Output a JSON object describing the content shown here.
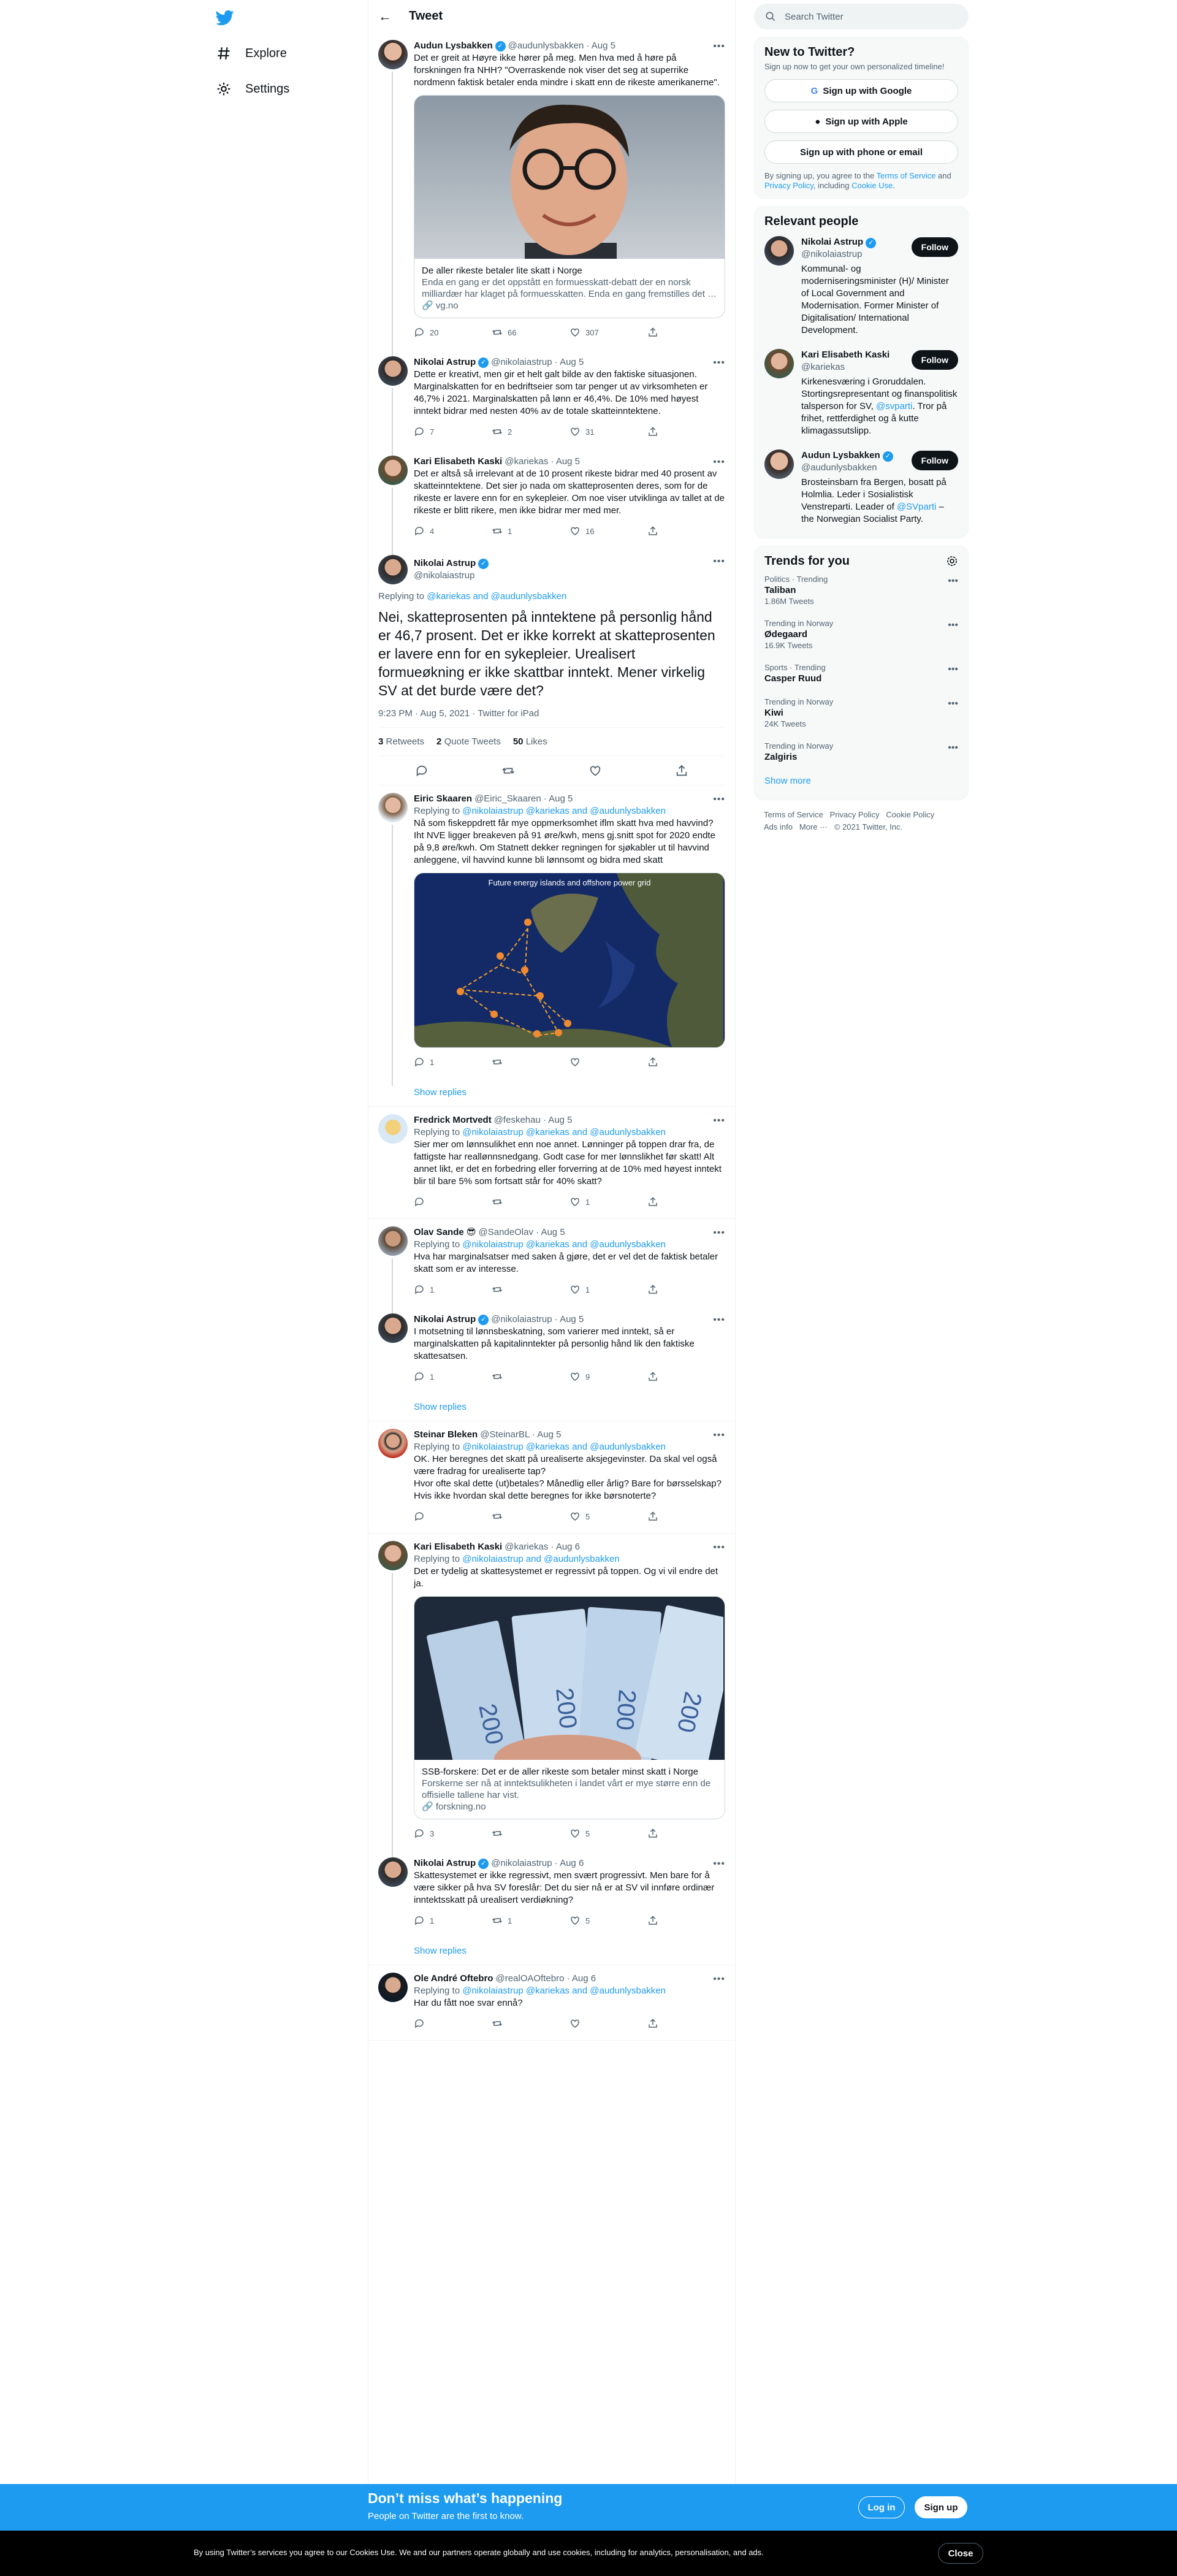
{
  "colors": {
    "accent": "#1d9bf0",
    "text": "#0f1419",
    "muted": "#536471"
  },
  "nav": {
    "explore": "Explore",
    "settings": "Settings"
  },
  "header": {
    "title": "Tweet"
  },
  "tweets": [
    {
      "name": "Audun Lysbakken",
      "meta": "@audunlysbakken · Aug 5",
      "replying": "",
      "text": "Det er greit at Høyre ikke hører på meg. Men hva med å høre på forskningen fra NHH? \"Overraskende nok viser det seg at superrike nordmenn faktisk betaler enda mindre i skatt enn de rikeste amerikanerne\".",
      "card_title": "De aller rikeste betaler lite skatt i Norge",
      "card_desc": "Enda en gang er det oppstått en formuesskatt-debatt der en norsk milliardær har klaget på formuesskatten. Enda en gang fremstilles det …",
      "card_domain": "vg.no",
      "reply": "20",
      "retweet": "66",
      "like": "307"
    },
    {
      "name": "Nikolai Astrup",
      "meta": "@nikolaiastrup · Aug 5",
      "replying": "",
      "text": "Dette er kreativt, men gir et helt galt bilde av den faktiske situasjonen. Marginalskatten for en bedriftseier som tar penger ut av virksomheten er 46,7% i 2021. Marginalskatten på lønn er 46,4%. De 10% med høyest inntekt bidrar med nesten 40% av de totale skatteinntektene.",
      "reply": "7",
      "retweet": "2",
      "like": "31"
    },
    {
      "name": "Kari Elisabeth Kaski",
      "meta": "@kariekas · Aug 5",
      "replying": "",
      "text": "Det er altså så irrelevant at de 10 prosent rikeste bidrar med 40 prosent av skatteinntektene. Det sier jo nada om skatteprosenten deres, som for de rikeste er lavere enn for en sykepleier. Om noe viser utviklinga av tallet at de rikeste er blitt rikere, men ikke bidrar mer med mer.",
      "reply": "4",
      "retweet": "1",
      "like": "16"
    }
  ],
  "focal": {
    "name": "Nikolai Astrup",
    "handle": "@nikolaiastrup",
    "replying_prefix": "Replying to ",
    "replying_users": "@kariekas and @audunlysbakken",
    "text": "Nei, skatteprosenten på inntektene på personlig hånd er 46,7 prosent. Det er ikke korrekt at skatteprosenten er lavere enn for en sykepleier. Urealisert formueøkning er ikke skattbar inntekt. Mener virkelig SV at det burde være det?",
    "timestamp": "9:23 PM · Aug 5, 2021 · Twitter for iPad",
    "retweets_num": "3",
    "retweets_label": "Retweets",
    "quotes_num": "2",
    "quotes_label": "Quote Tweets",
    "likes_num": "50",
    "likes_label": "Likes"
  },
  "replies": [
    {
      "name": "Eiric Skaaren",
      "meta": "@Eiric_Skaaren · Aug 5",
      "replying_prefix": "Replying to ",
      "replying_users": "@nikolaiastrup @kariekas and @audunlysbakken",
      "text": "Nå som fiskeppdrett får mye oppmerksomhet iflm skatt hva med havvind? Iht NVE ligger breakeven på 91 øre/kwh, mens gj.snitt spot for 2020 endte på 9,8 øre/kwh. Om Statnett dekker regningen for sjøkabler ut til havvind anleggene, vil havvind kunne bli lønnsomt og bidra med skatt",
      "media_title": "Future energy islands and offshore power grid",
      "reply": "1",
      "retweet": "",
      "like": ""
    },
    {
      "name": "Fredrick Mortvedt",
      "meta": "@feskehau · Aug 5",
      "replying_prefix": "Replying to ",
      "replying_users": "@nikolaiastrup @kariekas and @audunlysbakken",
      "text": "Sier mer om lønnsulikhet enn noe annet. Lønninger på toppen drar fra, de fattigste har reallønnsnedgang. Godt case for mer lønnslikhet før skatt! Alt annet likt, er det en forbedring eller forverring at de 10% med høyest inntekt blir til bare 5% som fortsatt står for 40% skatt?",
      "reply": "",
      "retweet": "",
      "like": "1"
    },
    {
      "name": "Olav Sande 😎",
      "meta": "@SandeOlav · Aug 5",
      "replying_prefix": "Replying to ",
      "replying_users": "@nikolaiastrup @kariekas and @audunlysbakken",
      "text": "Hva har marginalsatser med saken å gjøre, det er vel det de faktisk betaler skatt som er av interesse.",
      "reply": "1",
      "retweet": "",
      "like": "1"
    },
    {
      "name": "Nikolai Astrup",
      "meta": "@nikolaiastrup · Aug 5",
      "replying_prefix": "",
      "replying_users": "",
      "text": "I motsetning til lønnsbeskatning, som varierer med inntekt, så er marginalskatten på kapitalinntekter på personlig hånd lik den faktiske skattesatsen.",
      "reply": "1",
      "retweet": "",
      "like": "9"
    },
    {
      "name": "Steinar Bleken",
      "meta": "@SteinarBL · Aug 5",
      "replying_prefix": "Replying to ",
      "replying_users": "@nikolaiastrup @kariekas and @audunlysbakken",
      "text": "OK. Her beregnes det skatt på urealiserte aksjegevinster. Da skal vel også være fradrag for urealiserte tap?\nHvor ofte skal dette (ut)betales? Månedlig eller årlig? Bare for børsselskap?\nHvis ikke hvordan skal dette beregnes for ikke børsnoterte?",
      "reply": "",
      "retweet": "",
      "like": "5"
    },
    {
      "name": "Kari Elisabeth Kaski",
      "meta": "@kariekas · Aug 6",
      "replying_prefix": "Replying to ",
      "replying_users": "@nikolaiastrup and @audunlysbakken",
      "text": "Det er tydelig at skattesystemet er regressivt på toppen. Og vi vil endre det ja.",
      "card_title": "SSB-forskere: Det er de aller rikeste som betaler minst skatt i Norge",
      "card_desc": "Forskerne ser nå at inntektsulikheten i landet vårt er mye større enn de offisielle tallene har vist.",
      "card_domain": "forskning.no",
      "reply": "3",
      "retweet": "",
      "like": "5"
    },
    {
      "name": "Nikolai Astrup",
      "meta": "@nikolaiastrup · Aug 6",
      "replying_prefix": "",
      "replying_users": "",
      "text": "Skattesystemet er ikke regressivt, men svært progressivt. Men bare for å være sikker på hva SV foreslår: Det du sier nå er at SV vil innføre ordinær inntektsskatt på urealisert verdiøkning?",
      "reply": "1",
      "retweet": "1",
      "like": "5"
    },
    {
      "name": "Ole André Oftebro",
      "meta": "@realOAOftebro · Aug 6",
      "replying_prefix": "Replying to ",
      "replying_users": "@nikolaiastrup @kariekas and @audunlysbakken",
      "text": "Har du fått noe svar ennå?",
      "reply": "",
      "retweet": "",
      "like": ""
    }
  ],
  "show_replies": "Show replies",
  "search": {
    "placeholder": "Search Twitter"
  },
  "signup": {
    "title": "New to Twitter?",
    "subtitle": "Sign up now to get your own personalized timeline!",
    "google": "Sign up with Google",
    "apple": "Sign up with Apple",
    "phone": "Sign up with phone or email",
    "terms_a": "By signing up, you agree to the ",
    "terms_link1": "Terms of Service",
    "terms_b": " and ",
    "terms_link2": "Privacy Policy",
    "terms_c": ", including ",
    "terms_link3": "Cookie Use",
    "terms_d": "."
  },
  "relevant": {
    "title": "Relevant people",
    "follow": "Follow",
    "people": [
      {
        "name": "Nikolai Astrup",
        "handle": "@nikolaiastrup",
        "bio": "Kommunal- og moderniseringsminister (H)/ Minister of Local Government and Modernisation. Former Minister of Digitalisation/ International Development."
      },
      {
        "name": "Kari Elisabeth Kaski",
        "handle": "@kariekas",
        "bio_a": "Kirkenesværing i Grorud​dalen. Stortingsrepresentant og finanspolitisk talsperson for SV, ",
        "bio_link": "@svparti",
        "bio_b": ". Tror på frihet, rettferdighet og å kutte klimagassutslipp."
      },
      {
        "name": "Audun Lysbakken",
        "handle": "@audunlysbakken",
        "bio_a": "Brosteinsbarn fra Bergen, bosatt på Holmlia. Leder i Sosialistisk Venstreparti. Leader of ",
        "bio_link": "@SVparti",
        "bio_b": " – the Norwegian Socialist Party."
      }
    ]
  },
  "trends": {
    "title": "Trends for you",
    "items": [
      {
        "cat": "Politics · Trending",
        "name": "Taliban",
        "count": "1.86M Tweets"
      },
      {
        "cat": "Trending in Norway",
        "name": "Ødegaard",
        "count": "16.9K Tweets"
      },
      {
        "cat": "Sports · Trending",
        "name": "Casper Ruud",
        "count": ""
      },
      {
        "cat": "Trending in Norway",
        "name": "Kiwi",
        "count": "24K Tweets"
      },
      {
        "cat": "Trending in Norway",
        "name": "Zalgiris",
        "count": ""
      }
    ],
    "show_more": "Show more"
  },
  "footer": {
    "l1": "Terms of Service",
    "l2": "Privacy Policy",
    "l3": "Cookie Policy",
    "l4": "Ads info",
    "l5": "More ···",
    "copy": "© 2021 Twitter, Inc."
  },
  "bottom": {
    "title": "Don’t miss what’s happening",
    "sub": "People on Twitter are the first to know.",
    "login": "Log in",
    "signup": "Sign up"
  },
  "cookie": {
    "text": "By using Twitter’s services you agree to our Cookies Use. We and our partners operate globally and use cookies, including for analytics, personalisation, and ads.",
    "close": "Close"
  }
}
